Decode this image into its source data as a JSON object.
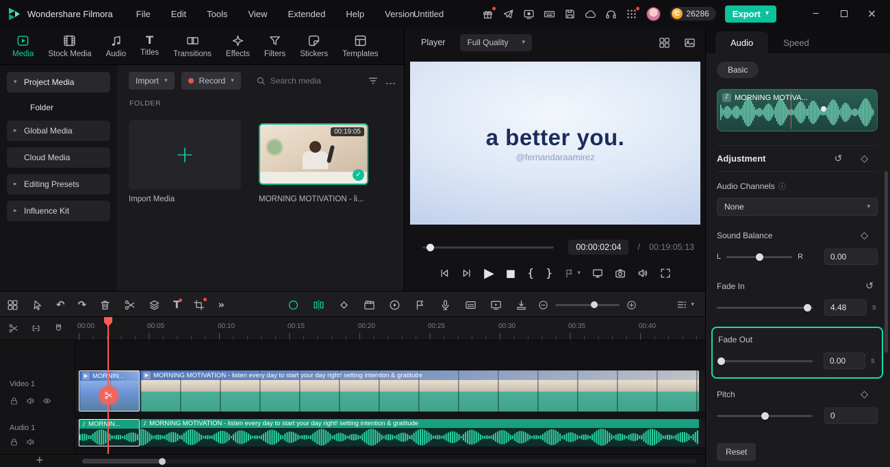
{
  "colors": {
    "accent": "#0fcf9f",
    "playhead": "#ff5a55"
  },
  "titlebar": {
    "app_name": "Wondershare Filmora",
    "menus": [
      "File",
      "Edit",
      "Tools",
      "View",
      "Extended",
      "Help",
      "Version"
    ],
    "project_name": "Untitled",
    "coin_count": "26286",
    "export_label": "Export"
  },
  "media_nav": {
    "tabs": [
      "Media",
      "Stock Media",
      "Audio",
      "Titles",
      "Transitions",
      "Effects",
      "Filters",
      "Stickers",
      "Templates"
    ],
    "active_tab": "Media"
  },
  "sidebar": {
    "items": [
      {
        "label": "Project Media"
      },
      {
        "label": "Folder"
      },
      {
        "label": "Global Media"
      },
      {
        "label": "Cloud Media"
      },
      {
        "label": "Editing Presets"
      },
      {
        "label": "Influence Kit"
      }
    ]
  },
  "media_panel": {
    "import_button": "Import",
    "record_button": "Record",
    "search_placeholder": "Search media",
    "section_label": "FOLDER",
    "import_tile_label": "Import Media",
    "clip": {
      "name": "MORNING MOTIVATION - li...",
      "duration": "00:19:05"
    }
  },
  "player": {
    "label": "Player",
    "quality": "Full Quality",
    "preview_line1": "a better you.",
    "preview_line2": "@fernandaraamirez",
    "current_time": "00:00:02:04",
    "separator": "/",
    "total_time": "00:19:05:13"
  },
  "inspector": {
    "tabs": [
      "Audio",
      "Speed"
    ],
    "active_tab": "Audio",
    "subtab": "Basic",
    "clip_name": "MORNING MOTIVA...",
    "section": "Adjustment",
    "audio_channels": {
      "label": "Audio Channels",
      "value": "None"
    },
    "sound_balance": {
      "label": "Sound Balance",
      "left": "L",
      "right": "R",
      "value": "0.00"
    },
    "fade_in": {
      "label": "Fade In",
      "value": "4.48",
      "unit": "s"
    },
    "fade_out": {
      "label": "Fade Out",
      "value": "0.00",
      "unit": "s"
    },
    "pitch": {
      "label": "Pitch",
      "value": "0"
    },
    "reset_label": "Reset"
  },
  "timeline": {
    "ruler_labels": [
      "00:00",
      "00:05",
      "00:10",
      "00:15",
      "00:20",
      "00:25",
      "00:30",
      "00:35",
      "00:40"
    ],
    "tracks": [
      {
        "name": "Video 1"
      },
      {
        "name": "Audio 1"
      }
    ],
    "video_clip_left_label": "MORNIN...",
    "video_clip_label": "MORNING MOTIVATION - listen every day to start your day right! setting intention & gratitude",
    "audio_clip_left_label": "MORNIN...",
    "audio_clip_label": "MORNING MOTIVATION - listen every day to start your day right! setting intention & gratitude"
  },
  "icons": {
    "chevron_down": "▾",
    "caret_right": "▸",
    "caret_down": "▾",
    "music_note": "♪",
    "plus": "+",
    "undo": "↶",
    "redo": "↷",
    "reset": "↺",
    "diamond": "◇",
    "info": "ⓘ",
    "play": "▶",
    "stop": "■",
    "brace_open": "{",
    "brace_close": "}",
    "ellipsis": "…",
    "double_chevron": "»",
    "check": "✓",
    "letter_T": "T",
    "close": "×",
    "minimize": "─"
  }
}
